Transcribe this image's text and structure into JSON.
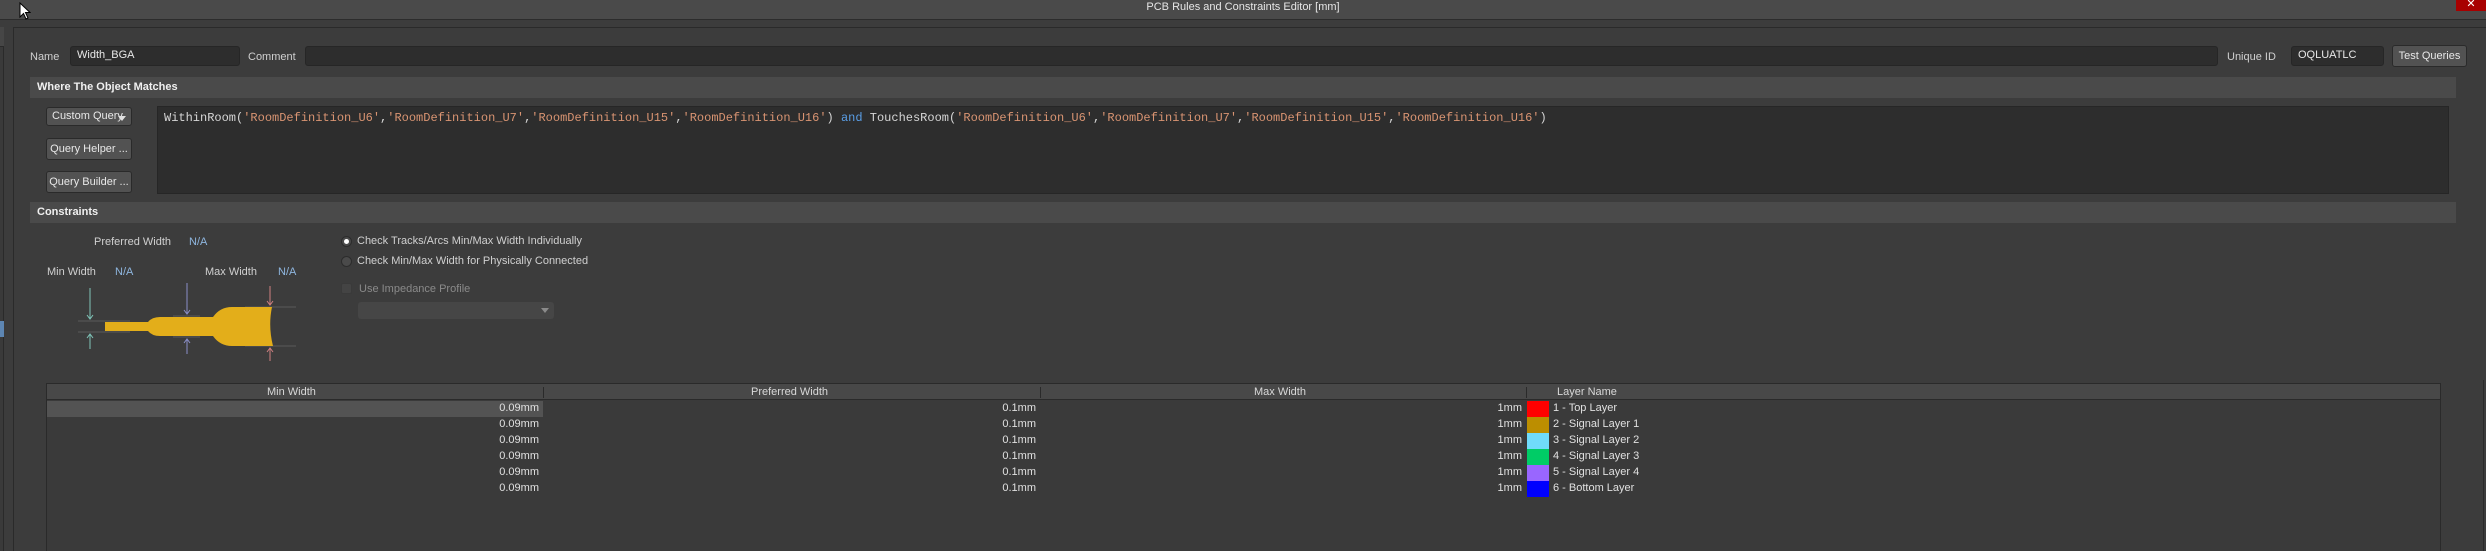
{
  "window": {
    "title": "PCB Rules and Constraints Editor [mm]",
    "close_glyph": "✕"
  },
  "header": {
    "name_label": "Name",
    "name_value": "Width_BGA",
    "comment_label": "Comment",
    "comment_value": "",
    "unique_id_label": "Unique ID",
    "unique_id_value": "OQLUATLC",
    "test_queries_label": "Test Queries"
  },
  "where_section": {
    "title": "Where The Object Matches",
    "query_type": "Custom Query",
    "query_helper_label": "Query Helper ...",
    "query_builder_label": "Query Builder ...",
    "query": {
      "fn1": "WithinRoom",
      "open": "(",
      "close": ")",
      "comma": ",",
      "args1": [
        "'RoomDefinition_U6'",
        "'RoomDefinition_U7'",
        "'RoomDefinition_U15'",
        "'RoomDefinition_U16'"
      ],
      "operator": "and",
      "fn2": "TouchesRoom",
      "args2": [
        "'RoomDefinition_U6'",
        "'RoomDefinition_U7'",
        "'RoomDefinition_U15'",
        "'RoomDefinition_U16'"
      ]
    }
  },
  "constraints_section": {
    "title": "Constraints",
    "preferred_width_label": "Preferred Width",
    "preferred_width_value": "N/A",
    "min_width_label": "Min Width",
    "min_width_value": "N/A",
    "max_width_label": "Max Width",
    "max_width_value": "N/A",
    "options": [
      {
        "label": "Check Tracks/Arcs Min/Max Width Individually",
        "selected": true
      },
      {
        "label": "Check Min/Max Width for Physically Connected",
        "selected": false
      }
    ],
    "impedance_label": "Use Impedance Profile",
    "impedance_checked": false,
    "impedance_profile_value": ""
  },
  "diagram_colors": {
    "track": "#e3ae1a",
    "min_arrow": "#7fc4b8",
    "pref_arrow": "#8a8ec8",
    "max_arrow": "#d08080"
  },
  "layer_table": {
    "columns": [
      "Min Width",
      "Preferred Width",
      "Max Width",
      "Layer Name"
    ],
    "rows": [
      {
        "min": "0.09mm",
        "preferred": "0.1mm",
        "max": "1mm",
        "layer": "1 - Top Layer",
        "color": "#ff0000"
      },
      {
        "min": "0.09mm",
        "preferred": "0.1mm",
        "max": "1mm",
        "layer": "2 - Signal Layer 1",
        "color": "#bc8e00"
      },
      {
        "min": "0.09mm",
        "preferred": "0.1mm",
        "max": "1mm",
        "layer": "3 - Signal Layer 2",
        "color": "#70dbfa"
      },
      {
        "min": "0.09mm",
        "preferred": "0.1mm",
        "max": "1mm",
        "layer": "4 - Signal Layer 3",
        "color": "#00cc66"
      },
      {
        "min": "0.09mm",
        "preferred": "0.1mm",
        "max": "1mm",
        "layer": "5 - Signal Layer 4",
        "color": "#9966ff"
      },
      {
        "min": "0.09mm",
        "preferred": "0.1mm",
        "max": "1mm",
        "layer": "6 - Bottom Layer",
        "color": "#0000ff"
      }
    ]
  }
}
